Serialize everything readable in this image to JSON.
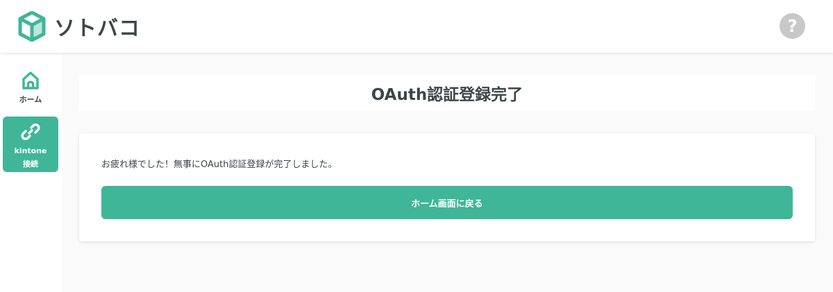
{
  "app": {
    "brand_name": "ソトバコ",
    "accent_color": "#3fb697"
  },
  "header": {
    "help_icon": "question-circle-icon",
    "help_symbol": "?"
  },
  "sidebar": {
    "items": [
      {
        "label": "ホーム",
        "icon": "home-icon",
        "active": false
      },
      {
        "label_line1": "kintone",
        "label_line2": "接続",
        "icon": "link-icon",
        "active": true
      }
    ]
  },
  "main": {
    "title": "OAuth認証登録完了",
    "message": "お疲れ様でした！無事にOAuth認証登録が完了しました。",
    "button_label": "ホーム画面に戻る"
  }
}
